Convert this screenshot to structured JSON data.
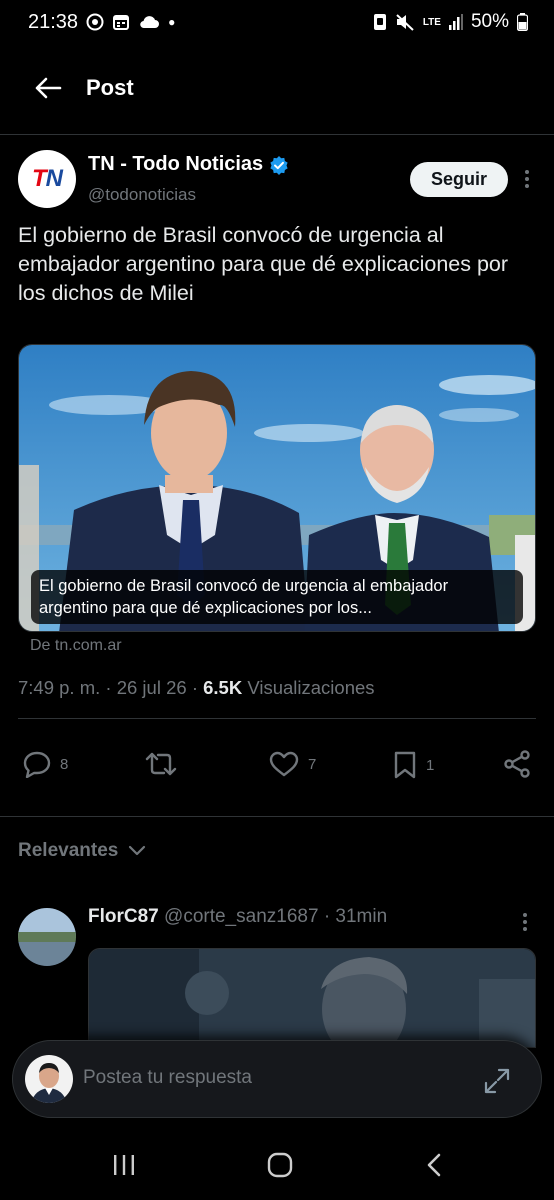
{
  "status_bar": {
    "time": "21:38",
    "battery": "50%",
    "network": "LTE",
    "icons_left": [
      "chrome-icon",
      "calendar-icon",
      "cloud-icon",
      "dot-icon"
    ],
    "icons_right": [
      "notification-icon",
      "mute-icon",
      "lte-icon",
      "signal-icon",
      "battery-icon"
    ]
  },
  "header": {
    "back_icon": "arrow-left-icon",
    "title": "Post"
  },
  "tweet": {
    "author_name": "TN - Todo Noticias",
    "author_handle": "@todonoticias",
    "verified": true,
    "logo_text": "TN",
    "follow_label": "Seguir",
    "text": "El gobierno de Brasil convocó de urgencia al embajador argentino para que dé explicaciones por los dichos de Milei",
    "media_caption": "El gobierno de Brasil convocó de urgencia al embajador argentino para que dé explicaciones por los...",
    "media_source": "De tn.com.ar",
    "time": "7:49 p. m.",
    "date": "26 jul 26",
    "views_count": "6.5K",
    "views_label": "Visualizaciones",
    "actions": {
      "replies": "8",
      "reposts": "",
      "likes": "7",
      "bookmarks": "1"
    }
  },
  "replies_section": {
    "sort_label": "Relevantes"
  },
  "reply": {
    "author_name": "FlorC87",
    "author_handle": "@corte_sanz1687",
    "time": "31min"
  },
  "composer": {
    "placeholder": "Postea tu respuesta"
  },
  "colors": {
    "background": "#000000",
    "text_primary": "#e7e9ea",
    "text_secondary": "#71767b",
    "verified": "#1d9bf0",
    "divider": "#2f3336"
  }
}
